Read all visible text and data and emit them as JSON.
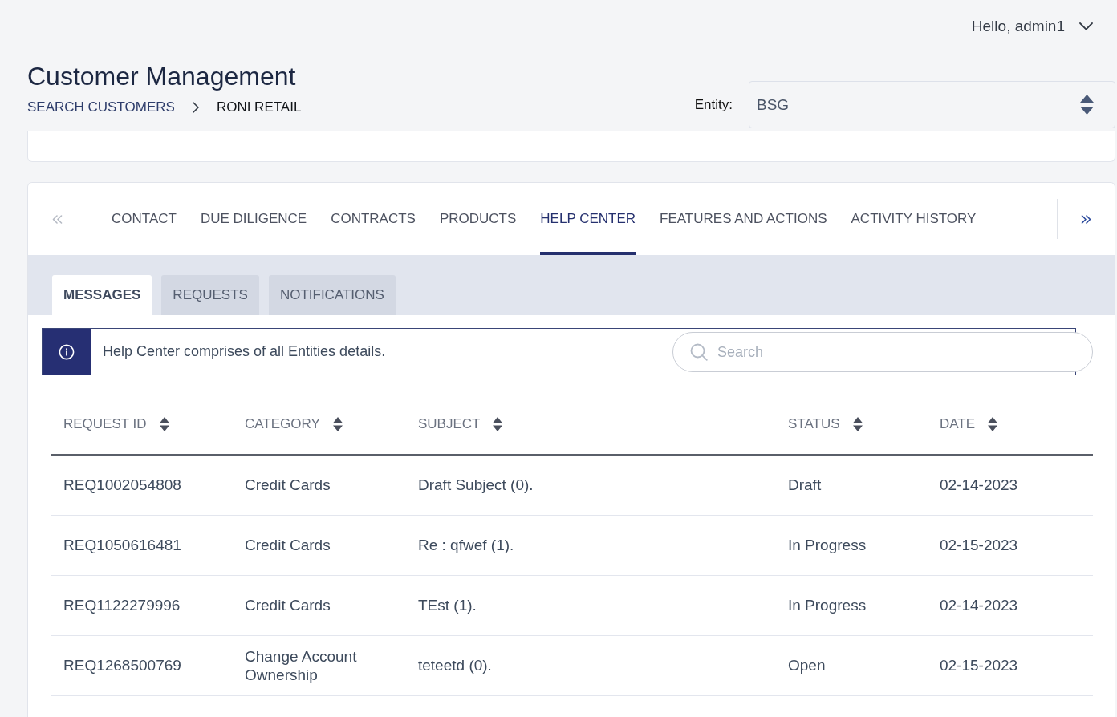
{
  "header": {
    "user_menu": {
      "label": "Hello, admin1"
    }
  },
  "page": {
    "title": "Customer Management",
    "breadcrumb": [
      {
        "label": "SEARCH CUSTOMERS",
        "kind": "link"
      },
      {
        "label": "RONI RETAIL",
        "kind": "current"
      }
    ]
  },
  "entity_select": {
    "label": "Entity:",
    "value": "BSG"
  },
  "tab_nav": {
    "previous": {
      "disabled": true
    },
    "next": {
      "disabled": false
    }
  },
  "tabs": [
    {
      "label": "CONTACT",
      "selected": false
    },
    {
      "label": "DUE DILIGENCE",
      "selected": false
    },
    {
      "label": "CONTRACTS",
      "selected": false
    },
    {
      "label": "PRODUCTS",
      "selected": false
    },
    {
      "label": "HELP CENTER",
      "selected": true
    },
    {
      "label": "FEATURES AND ACTIONS",
      "selected": false
    },
    {
      "label": "ACTIVITY HISTORY",
      "selected": false
    }
  ],
  "sub_tabs": [
    {
      "label": "MESSAGES",
      "selected": true
    },
    {
      "label": "REQUESTS",
      "selected": false
    },
    {
      "label": "NOTIFICATIONS",
      "selected": false
    }
  ],
  "info_banner": {
    "text": "Help Center comprises of all Entities details."
  },
  "search": {
    "placeholder": "Search"
  },
  "table": {
    "columns": [
      "REQUEST ID",
      "CATEGORY",
      "SUBJECT",
      "STATUS",
      "DATE"
    ],
    "rows": [
      [
        "REQ1002054808",
        "Credit Cards",
        "Draft Subject (0).",
        "Draft",
        "02-14-2023"
      ],
      [
        "REQ1050616481",
        "Credit Cards",
        "Re : qfwef (1).",
        "In Progress",
        "02-15-2023"
      ],
      [
        "REQ1122279996",
        "Credit Cards",
        "TEst (1).",
        "In Progress",
        "02-14-2023"
      ],
      [
        "REQ1268500769",
        "Change Account Ownership",
        "teteetd (0).",
        "Open",
        "02-15-2023"
      ]
    ]
  }
}
